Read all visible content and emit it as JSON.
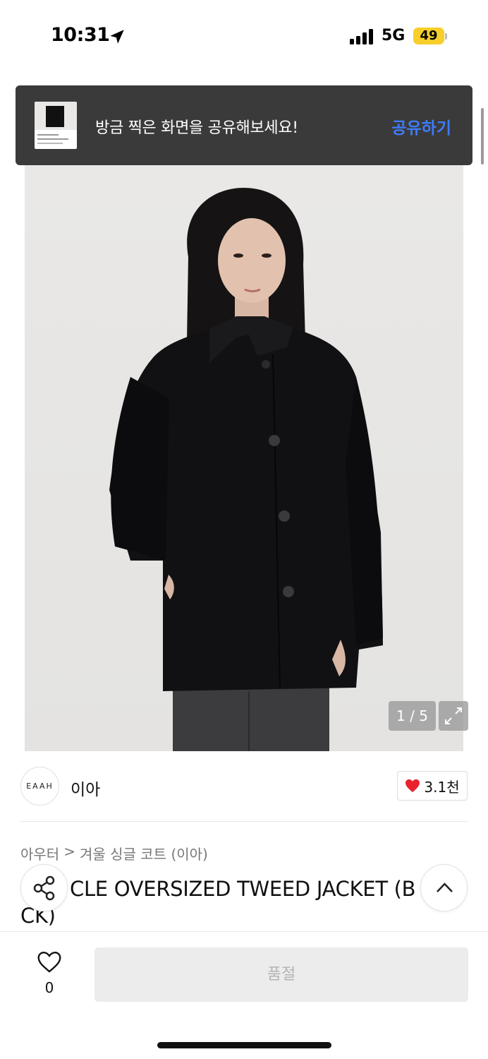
{
  "status_bar": {
    "time": "10:31",
    "network": "5G",
    "battery": "49"
  },
  "toast": {
    "message": "방금 찍은 화면을 공유해보세요!",
    "action": "공유하기"
  },
  "gallery": {
    "counter": "1 / 5"
  },
  "brand": {
    "logo_text": "EAAH",
    "name": "이아",
    "likes": "3.1천"
  },
  "breadcrumb": {
    "category": "아우터",
    "separator": ">",
    "subcategory": "겨울 싱글 코트 (이아)"
  },
  "product": {
    "title_visible": "CLE OVERSIZED TWEED JACKET (B",
    "title_wrap": "CK)"
  },
  "bottom_bar": {
    "wish_count": "0",
    "purchase_label": "품절"
  },
  "colors": {
    "accent": "#3d7cf5",
    "heart": "#e8232e",
    "toast_bg": "#3a3a3b",
    "soldout_bg": "#ececec",
    "battery": "#f7ce2a"
  },
  "icons": [
    "location-arrow-icon",
    "signal-icon",
    "expand-icon",
    "heart-icon",
    "share-icon",
    "chevron-up-icon"
  ]
}
